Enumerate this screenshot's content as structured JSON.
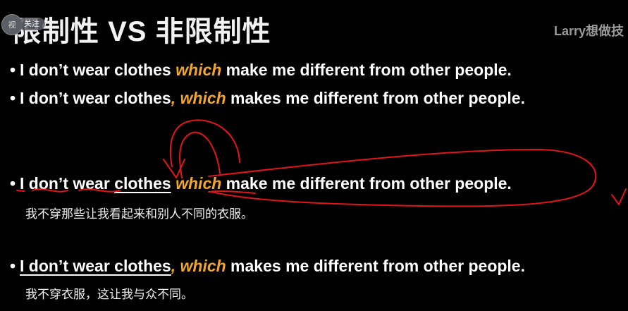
{
  "slide": {
    "title": "限制性 VS 非限制性",
    "watermark": "Larry想做技",
    "overlay": {
      "badge": "视",
      "pill": "关注"
    },
    "lines": [
      {
        "bullet": "•",
        "pre": "I don’t wear clothes ",
        "highlight": "which",
        "post": " make me different from other people."
      },
      {
        "bullet": "•",
        "pre": "I don’t wear clothes",
        "highlight": ", which",
        "post": " makes me different from other people."
      },
      {
        "bullet": "•",
        "pre": "I don’t wear ",
        "underlined": "clothes",
        "space": " ",
        "highlight": "which",
        "post": " make me different from other people.",
        "translation": "我不穿那些让我看起来和别人不同的衣服。"
      },
      {
        "bullet": "•",
        "underlined": "I don’t wear clothes",
        "highlight": ", which",
        "post": " makes me different from other people.",
        "translation": "我不穿衣服，这让我与众不同。"
      }
    ]
  },
  "colors": {
    "background": "#000000",
    "text": "#ffffff",
    "highlight": "#f2a62a",
    "annotation": "#e0161b",
    "watermark": "#9a9a9a"
  }
}
